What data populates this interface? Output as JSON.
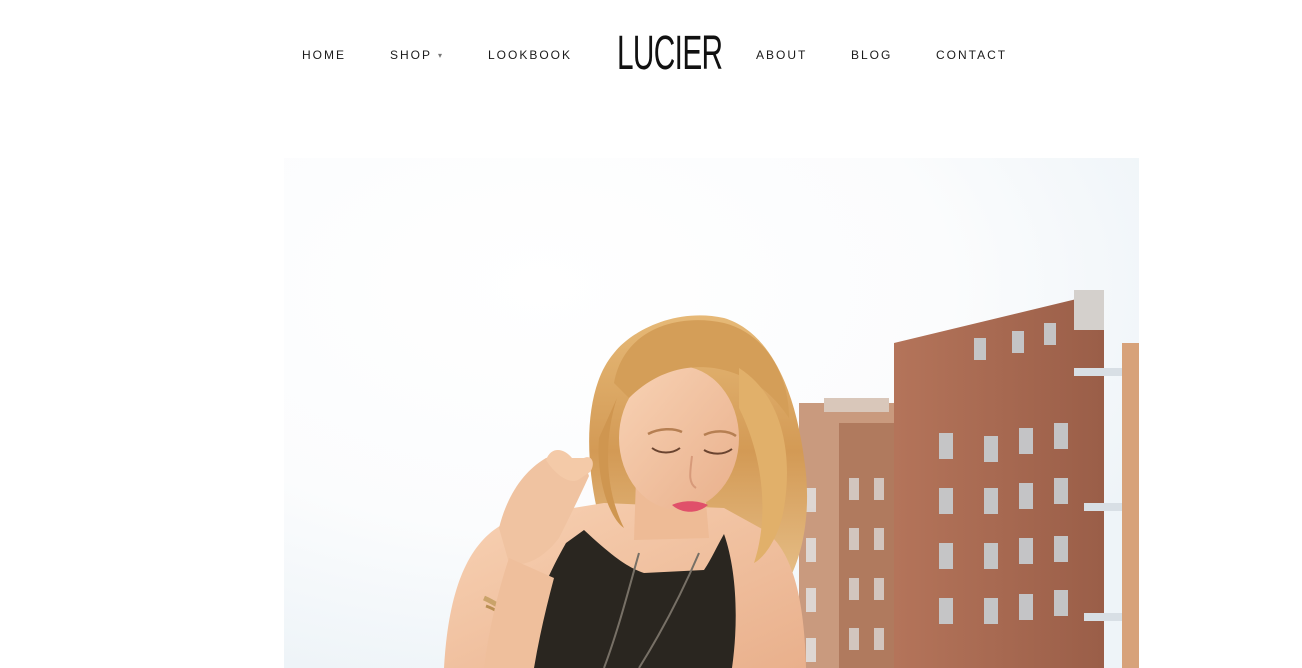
{
  "brand": {
    "logo_text": "LUCIER"
  },
  "nav": {
    "left": [
      {
        "label": "HOME"
      },
      {
        "label": "SHOP",
        "has_dropdown": true,
        "caret": "▾"
      },
      {
        "label": "LOOKBOOK"
      }
    ],
    "right": [
      {
        "label": "ABOUT"
      },
      {
        "label": "BLOG"
      },
      {
        "label": "CONTACT"
      }
    ]
  },
  "hero": {
    "image_subject": "fashion-model-photo",
    "colors": {
      "sky": "#f4f7f9",
      "brick": "#a86a52",
      "brick_dark": "#8e5542",
      "hair": "#d9a45e",
      "skin": "#f1c2a0",
      "top": "#2a2620"
    }
  }
}
